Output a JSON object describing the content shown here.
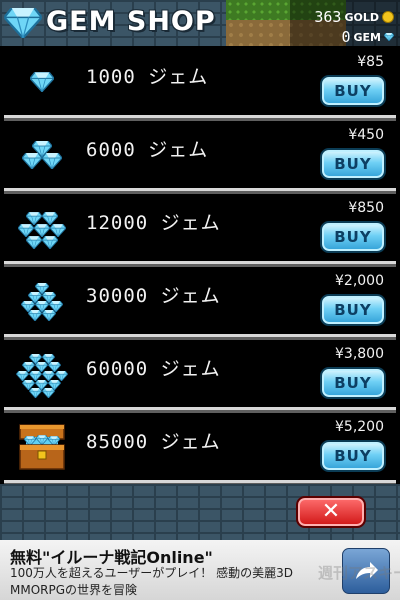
{
  "header": {
    "title": "GEM SHOP",
    "gold_count": "363",
    "gold_label": "GOLD",
    "gem_count": "0",
    "gem_label": "GEM"
  },
  "items": [
    {
      "amount": "1000 ジェム",
      "price": "¥85",
      "buy_label": "BUY",
      "icon": "single-gem-icon"
    },
    {
      "amount": "6000 ジェム",
      "price": "¥450",
      "buy_label": "BUY",
      "icon": "small-gem-pile-icon"
    },
    {
      "amount": "12000 ジェム",
      "price": "¥850",
      "buy_label": "BUY",
      "icon": "gem-pile-icon"
    },
    {
      "amount": "30000 ジェム",
      "price": "¥2,000",
      "buy_label": "BUY",
      "icon": "gem-heap-icon"
    },
    {
      "amount": "60000 ジェム",
      "price": "¥3,800",
      "buy_label": "BUY",
      "icon": "large-gem-heap-icon"
    },
    {
      "amount": "85000 ジェム",
      "price": "¥5,200",
      "buy_label": "BUY",
      "icon": "gem-treasure-chest-icon"
    }
  ],
  "close_label": "✕",
  "ad": {
    "title": "無料\"イルーナ戦記Online\"",
    "line1": "100万人を超えるユーザーがプレイ！ 感動の美麗3D",
    "line2": "MMORPGの世界を冒険",
    "icon": "share-arrow-icon",
    "watermark": "週刊アスキー"
  },
  "colors": {
    "buy_button": "#4fb9ea",
    "close_button": "#e3261f",
    "background": "#000000",
    "gem": "#5fd0f2"
  }
}
